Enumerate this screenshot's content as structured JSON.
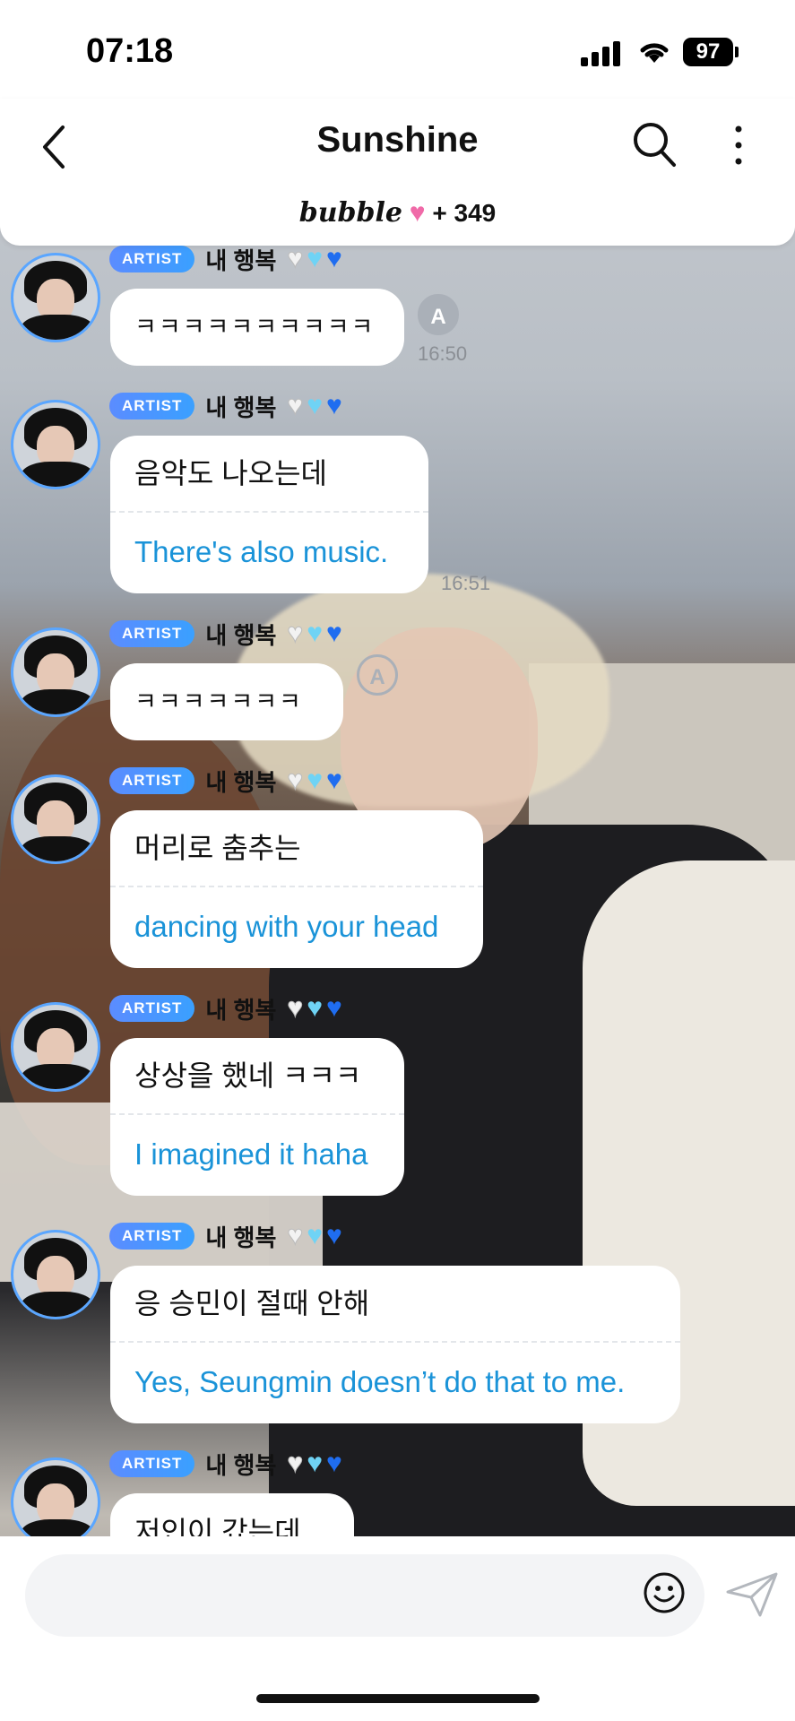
{
  "status_bar": {
    "time": "07:18",
    "battery": "97"
  },
  "header": {
    "title": "Sunshine",
    "brand": "bubble",
    "member_count": "+ 349"
  },
  "messages": [
    {
      "badge": "ARTIST",
      "name": "내 행복",
      "ko": "ㅋㅋㅋㅋㅋㅋㅋㅋㅋㅋ",
      "en": "",
      "time": "16:50"
    },
    {
      "badge": "ARTIST",
      "name": "내 행복",
      "ko": "음악도 나오는데",
      "en": "There's also music.",
      "time": "16:51"
    },
    {
      "badge": "ARTIST",
      "name": "내 행복",
      "ko": "ㅋㅋㅋㅋㅋㅋㅋㅋ",
      "en": "",
      "time": ""
    },
    {
      "badge": "ARTIST",
      "name": "내 행복",
      "ko": "머리로 춤추는",
      "en": "dancing with your head",
      "time": ""
    },
    {
      "badge": "ARTIST",
      "name": "내 행복",
      "ko": "상상을 했네 ㅋㅋㅋ",
      "en": "I imagined it haha",
      "time": ""
    },
    {
      "badge": "ARTIST",
      "name": "내 행복",
      "ko": "응 승민이 절때 안해",
      "en": "Yes, Seungmin doesn’t do that to me.",
      "time": ""
    },
    {
      "badge": "ARTIST",
      "name": "내 행복",
      "ko": "저인이 갔는데",
      "en": "",
      "time": ""
    }
  ],
  "composer": {
    "placeholder": ""
  },
  "icons": {
    "back": "chevron-left-icon",
    "search": "search-icon",
    "more": "more-vertical-icon",
    "emoji": "smiley-icon",
    "send": "send-icon",
    "forward": "auto-translate-icon"
  },
  "colors": {
    "accent": "#1a93d8",
    "badge": "#4d8fff",
    "avatar_ring": "#5aa6ff",
    "heart_pink": "#f06aa8"
  }
}
